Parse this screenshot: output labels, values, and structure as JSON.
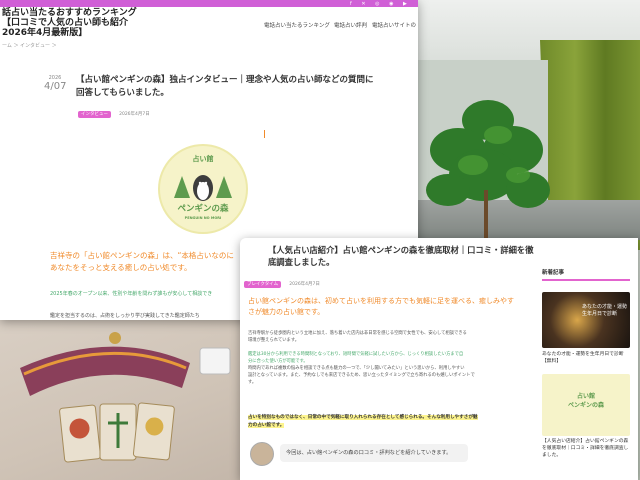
{
  "collage_title": "",
  "top_card": {
    "site_title_lines": [
      "話占い当たるおすすめランキング",
      "【口コミで人気の占い師も紹介",
      "2026年4月最新版】"
    ],
    "nav_items": [
      "電話占い当たるランキング",
      "電話占い評判",
      "電話占いサイトの"
    ],
    "breadcrumb": "ーム ＞ インタビュー ＞",
    "date_year": "2026",
    "date_md": "4/07",
    "article_title": "【占い館ペンギンの森】独占インタビュー｜理念や人気の占い師などの質問に回答してもらいました。",
    "tag": "インタビュー",
    "posted_date": "2026年4月7日",
    "logo": {
      "top": "占い館",
      "main": "ペンギンの森",
      "sub": "PENGUIN NO MORI"
    },
    "intro_orange": [
      "吉祥寺の「占い館ペンギンの森」は、“本格占いなのに",
      "あなたをそっと支える癒しの占い処です。"
    ],
    "green_line": "2025年春のオープン以来、性別や年齢を問わず誰もが安心して相談でき",
    "body_line": "鑑定を担当するのは、占術をしっかり学び実践してきた鑑定師たち"
  },
  "bottom_card": {
    "article_title": "【人気占い店紹介】占い館ペンギンの森を徹底取材｜口コミ・詳細を徹底調査しました。",
    "tag": "ブレイクタイム",
    "posted_date": "2026年4月7日",
    "lead_orange": [
      "占い館ペンギンの森は、初めて占いを利用する方でも気軽に足を運べる、癒しみやすさが魅力の占い館です。"
    ],
    "body_lines": [
      "吉祥寺駅から徒歩圏内という立地に加え、落ち着いた店内は非日常を感じる空間で女性でも、安心して相談できる",
      "環境が整えられています。",
      "",
      "鑑定は30分から利用できる時間制となっており、短時間で気軽に試したい方から、じっくり相談したい方まで自",
      "分に合った使い方が可能です。",
      "時間内であれば複数の悩みを相談できる点も魅力の一つで、「少し聞いてみたい」という思いから、利用しやすい",
      "設計となっています。また、予約なしでも来店できるため、思い立ったタイミングで立ち寄れるのも嬉しいポイントで",
      "す。"
    ],
    "highlight_lines": [
      "占いを特別なものではなく、日常の中で気軽に取り入れられる存在として感じられる。そんな利用しやすさが魅",
      "力の占い館です。"
    ],
    "chat_text": "今回は、占い館ペンギンの森の口コミ・評判などを紹介していきます。",
    "sidebar_heading": "新着記事",
    "sidebar_items": [
      {
        "thumb_text": "あなたの才能・運勢\n生年月日で診断",
        "caption": "あなたの才能・運勢を生年月日で診断【無料】"
      },
      {
        "thumb_text": "占い館\nペンギンの森",
        "caption": "【人気占い店紹介】占い館ペンギンの森を徹底取材｜口コミ・詳細を徹底調査しました。"
      }
    ]
  },
  "colors": {
    "accent_pink": "#e264ce",
    "orange": "#f08a2a",
    "green_logo": "#5e9b4e"
  }
}
